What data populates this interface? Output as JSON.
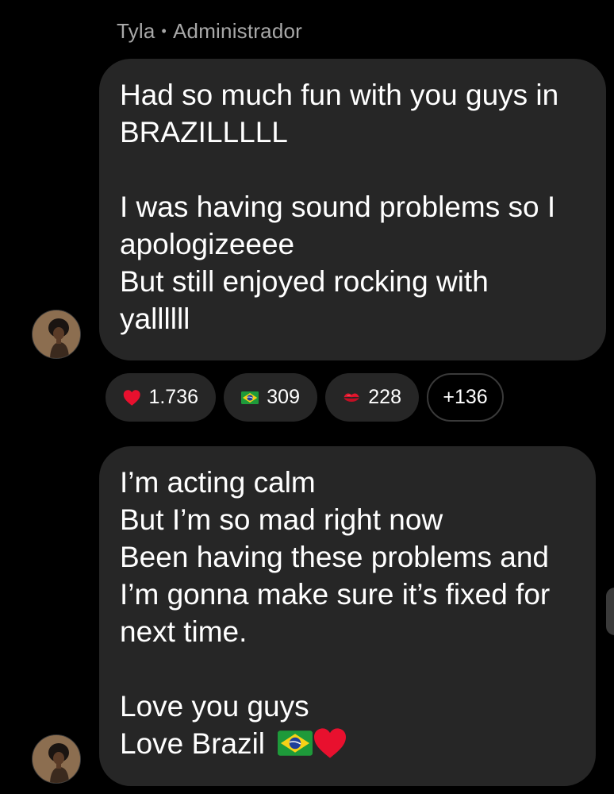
{
  "header": {
    "sender_name": "Tyla",
    "separator": "•",
    "sender_role": "Administrador"
  },
  "messages": [
    {
      "lines": [
        "Had so much fun with you guys in",
        "BRAZILLLLL",
        "",
        "I was having sound problems so I",
        "apologizeeee",
        "But still enjoyed rocking with",
        "yallllll"
      ]
    },
    {
      "lines": [
        "I’m acting calm",
        "But I’m so mad right now",
        "Been having these problems and",
        "I’m gonna make sure it’s fixed for",
        "next time.",
        "",
        "Love you guys",
        "Love Brazil"
      ]
    }
  ],
  "reactions": [
    {
      "icon": "red-heart-icon",
      "count": "1.736"
    },
    {
      "icon": "brazil-flag-icon",
      "count": "309"
    },
    {
      "icon": "kiss-mark-icon",
      "count": "228"
    },
    {
      "icon": "",
      "count": "+136"
    }
  ],
  "colors": {
    "background": "#000000",
    "bubble": "#262626",
    "secondary_text": "#a8a8a8",
    "heart": "#e8102e"
  }
}
